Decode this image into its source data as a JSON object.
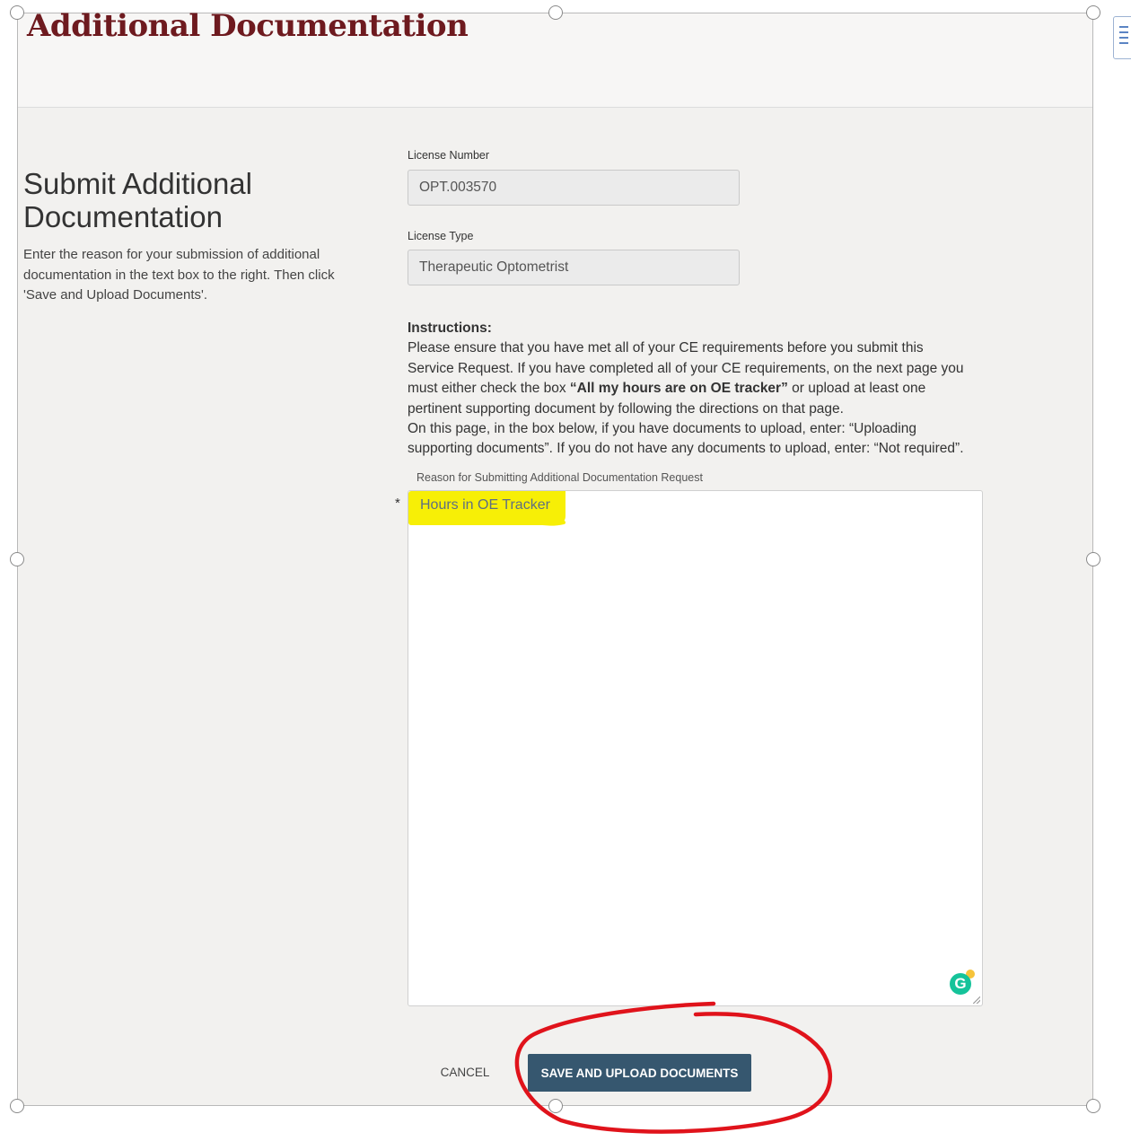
{
  "header": {
    "title": "Additional Documentation"
  },
  "left_panel": {
    "heading": "Submit Additional Documentation",
    "description": "Enter the reason for your submission of additional documentation in the text box to the right. Then click 'Save and Upload Documents'."
  },
  "form": {
    "license_number": {
      "label": "License Number",
      "value": "OPT.003570"
    },
    "license_type": {
      "label": "License Type",
      "value": "Therapeutic Optometrist"
    },
    "instructions": {
      "title": "Instructions:",
      "text_1": "Please ensure that you have met all of your CE requirements before you submit this Service Request. If you have completed all of your CE requirements, on the next page you must either check the box ",
      "bold": "“All my hours are on OE tracker”",
      "text_2": " or upload at least one pertinent supporting document by following the directions on that page.",
      "text_3": "On this page, in the box below, if you have documents to upload, enter: “Uploading supporting documents”. If you do not have any documents to upload, enter: “Not required”."
    },
    "reason": {
      "label": "Reason for Submitting Additional Documentation Request",
      "required_marker": "*",
      "value": "Hours in OE Tracker"
    }
  },
  "actions": {
    "cancel_label": "CANCEL",
    "save_label": "SAVE AND UPLOAD DOCUMENTS"
  },
  "icons": {
    "grammarly": {
      "name": "grammarly-icon",
      "glyph": "G"
    }
  },
  "colors": {
    "title": "#6e1a1f",
    "primary_button": "#36576f",
    "highlight": "#f7ef06",
    "annotation": "#e0131b"
  }
}
